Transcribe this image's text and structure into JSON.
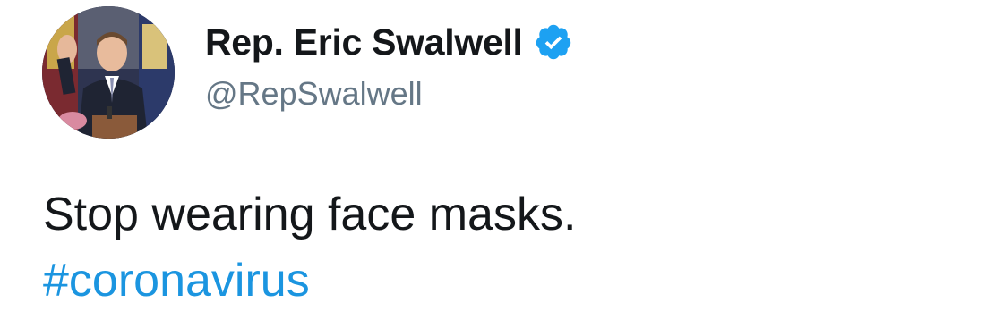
{
  "author": {
    "display_name": "Rep. Eric Swalwell",
    "handle": "@RepSwalwell",
    "verified": true,
    "avatar_icon": "profile-photo",
    "verified_icon": "verified-badge-icon"
  },
  "tweet": {
    "text": "Stop wearing face masks.",
    "hashtag": "#coronavirus"
  },
  "colors": {
    "text": "#14171a",
    "secondary": "#657786",
    "link": "#1b95e0",
    "verified": "#1da1f2"
  }
}
